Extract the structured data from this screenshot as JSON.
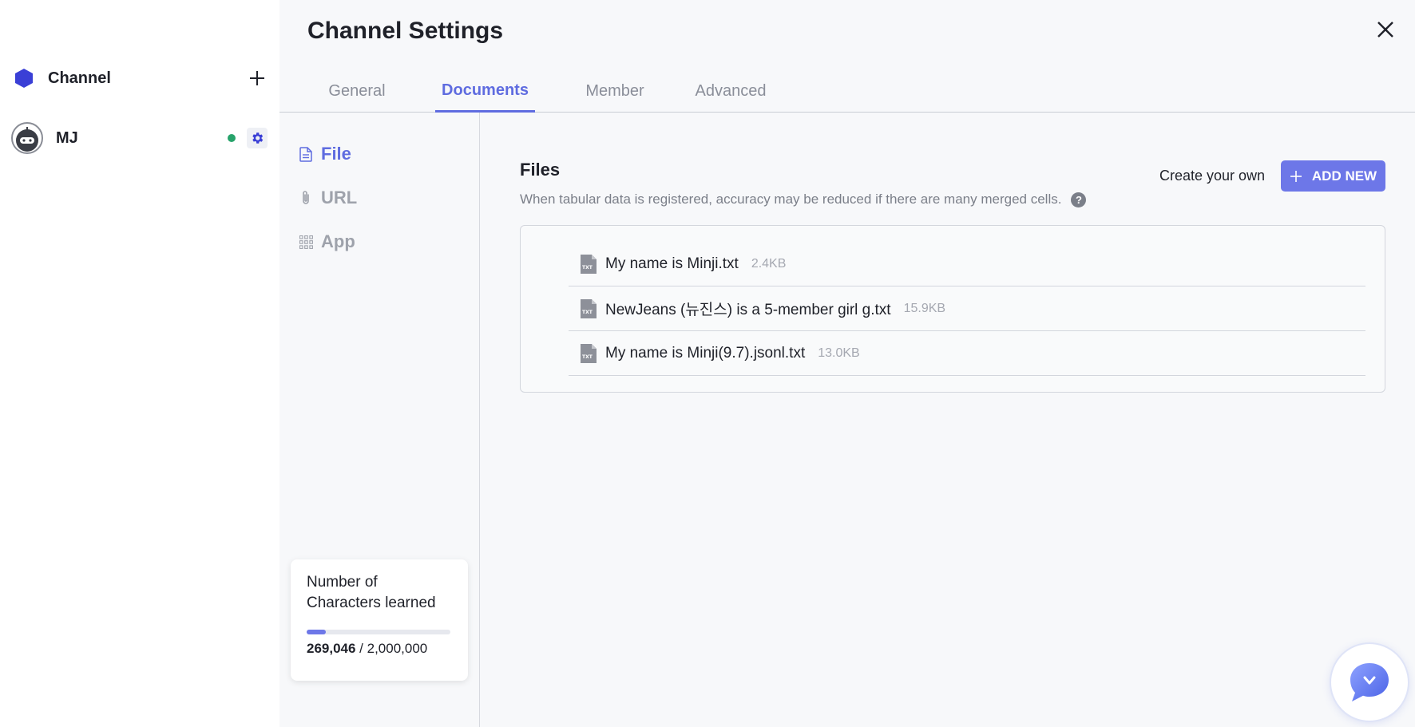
{
  "sidebar": {
    "channel_label": "Channel",
    "bot_name": "MJ"
  },
  "header": {
    "title": "Channel Settings"
  },
  "tabs": [
    {
      "label": "General"
    },
    {
      "label": "Documents"
    },
    {
      "label": "Member"
    },
    {
      "label": "Advanced"
    }
  ],
  "subnav": {
    "items": [
      {
        "label": "File",
        "icon": "file-icon"
      },
      {
        "label": "URL",
        "icon": "paperclip-icon"
      },
      {
        "label": "App",
        "icon": "grid-icon"
      }
    ]
  },
  "characters": {
    "title": "Number of Characters learned",
    "learned": "269,046",
    "separator": " / ",
    "limit": "2,000,000",
    "progress_fraction": 0.1345
  },
  "files": {
    "heading": "Files",
    "description": "When tabular data is registered, accuracy may be reduced if there are many merged cells.",
    "help_symbol": "?",
    "create_own_label": "Create your own",
    "add_new_label": "ADD NEW",
    "items": [
      {
        "name": "My name is Minji.txt",
        "size": "2.4KB"
      },
      {
        "name": "NewJeans (뉴진스) is a 5-member girl g.txt",
        "size": "15.9KB"
      },
      {
        "name": "My name is Minji(9.7).jsonl.txt",
        "size": "13.0KB"
      }
    ]
  },
  "colors": {
    "accent": "#5f6ce0",
    "button": "#6d77e8",
    "online": "#27a36b",
    "channel_hex": "#3a3fd6"
  }
}
